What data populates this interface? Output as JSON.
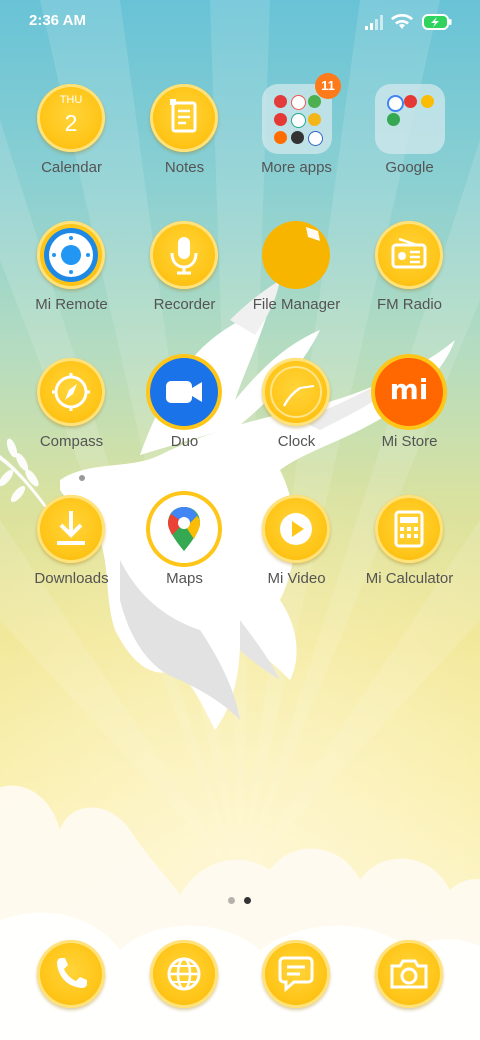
{
  "status_bar": {
    "time": "2:36 AM",
    "icons": [
      "signal-icon",
      "wifi-icon",
      "battery-charging-icon"
    ]
  },
  "apps": [
    {
      "label": "Calendar",
      "icon": "calendar-icon",
      "day": "THU",
      "date": "2"
    },
    {
      "label": "Notes",
      "icon": "notes-icon"
    },
    {
      "label": "More apps",
      "icon": "folder-icon",
      "badge": "11"
    },
    {
      "label": "Google",
      "icon": "folder-icon"
    },
    {
      "label": "Mi Remote",
      "icon": "remote-icon"
    },
    {
      "label": "Recorder",
      "icon": "microphone-icon"
    },
    {
      "label": "File Manager",
      "icon": "folder-files-icon"
    },
    {
      "label": "FM Radio",
      "icon": "radio-icon"
    },
    {
      "label": "Compass",
      "icon": "compass-icon"
    },
    {
      "label": "Duo",
      "icon": "video-camera-icon"
    },
    {
      "label": "Clock",
      "icon": "clock-icon"
    },
    {
      "label": "Mi Store",
      "icon": "mi-logo-icon",
      "logo_text": "mi"
    },
    {
      "label": "Downloads",
      "icon": "download-icon"
    },
    {
      "label": "Maps",
      "icon": "map-pin-icon"
    },
    {
      "label": "Mi Video",
      "icon": "play-icon"
    },
    {
      "label": "Mi Calculator",
      "icon": "calculator-icon"
    }
  ],
  "page_indicator": {
    "pages": 2,
    "current": 2
  },
  "dock": [
    {
      "icon": "phone-icon"
    },
    {
      "icon": "browser-globe-icon"
    },
    {
      "icon": "messages-icon"
    },
    {
      "icon": "camera-icon"
    }
  ],
  "colors": {
    "coin": "#ffc61a",
    "label": "#545454",
    "badge": "#ff7a1a",
    "mi_store": "#ff6700",
    "duo": "#1a73e8"
  }
}
